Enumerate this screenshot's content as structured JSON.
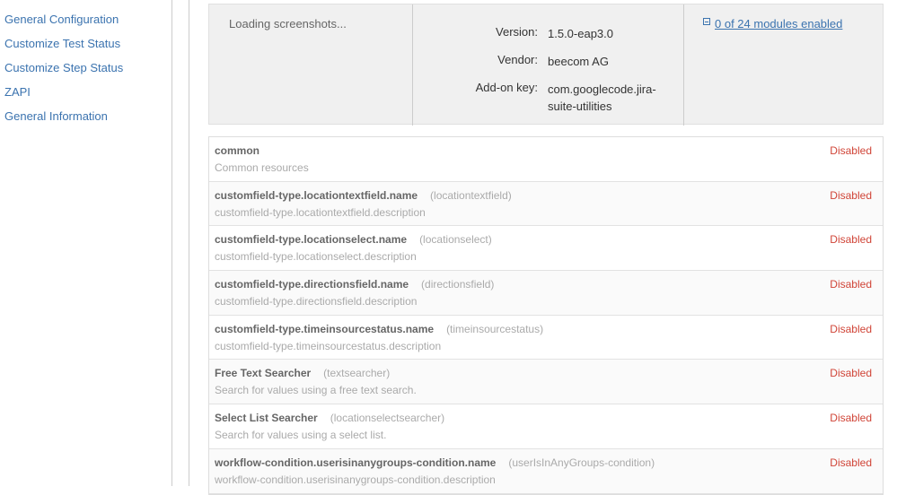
{
  "sidebar": {
    "items": [
      {
        "label": "General Configuration"
      },
      {
        "label": "Customize Test Status"
      },
      {
        "label": "Customize Step Status"
      },
      {
        "label": "ZAPI"
      },
      {
        "label": "General Information"
      }
    ]
  },
  "plugin": {
    "screenshots_loading": "Loading screenshots...",
    "version_label": "Version:",
    "version": "1.5.0-eap3.0",
    "vendor_label": "Vendor:",
    "vendor": "beecom AG",
    "addon_key_label": "Add-on key:",
    "addon_key": "com.googlecode.jira-suite-utilities",
    "modules_summary": "0 of 24 modules enabled"
  },
  "modules": [
    {
      "name": "common",
      "key": "",
      "description": "Common resources",
      "status": "Disabled"
    },
    {
      "name": "customfield-type.locationtextfield.name",
      "key": "(locationtextfield)",
      "description": "customfield-type.locationtextfield.description",
      "status": "Disabled"
    },
    {
      "name": "customfield-type.locationselect.name",
      "key": "(locationselect)",
      "description": "customfield-type.locationselect.description",
      "status": "Disabled"
    },
    {
      "name": "customfield-type.directionsfield.name",
      "key": "(directionsfield)",
      "description": "customfield-type.directionsfield.description",
      "status": "Disabled"
    },
    {
      "name": "customfield-type.timeinsourcestatus.name",
      "key": "(timeinsourcestatus)",
      "description": "customfield-type.timeinsourcestatus.description",
      "status": "Disabled"
    },
    {
      "name": "Free Text Searcher",
      "key": "(textsearcher)",
      "description": "Search for values using a free text search.",
      "status": "Disabled"
    },
    {
      "name": "Select List Searcher",
      "key": "(locationselectsearcher)",
      "description": "Search for values using a select list.",
      "status": "Disabled"
    },
    {
      "name": "workflow-condition.userisinanygroups-condition.name",
      "key": "(userIsInAnyGroups-condition)",
      "description": "workflow-condition.userisinanygroups-condition.description",
      "status": "Disabled"
    }
  ]
}
